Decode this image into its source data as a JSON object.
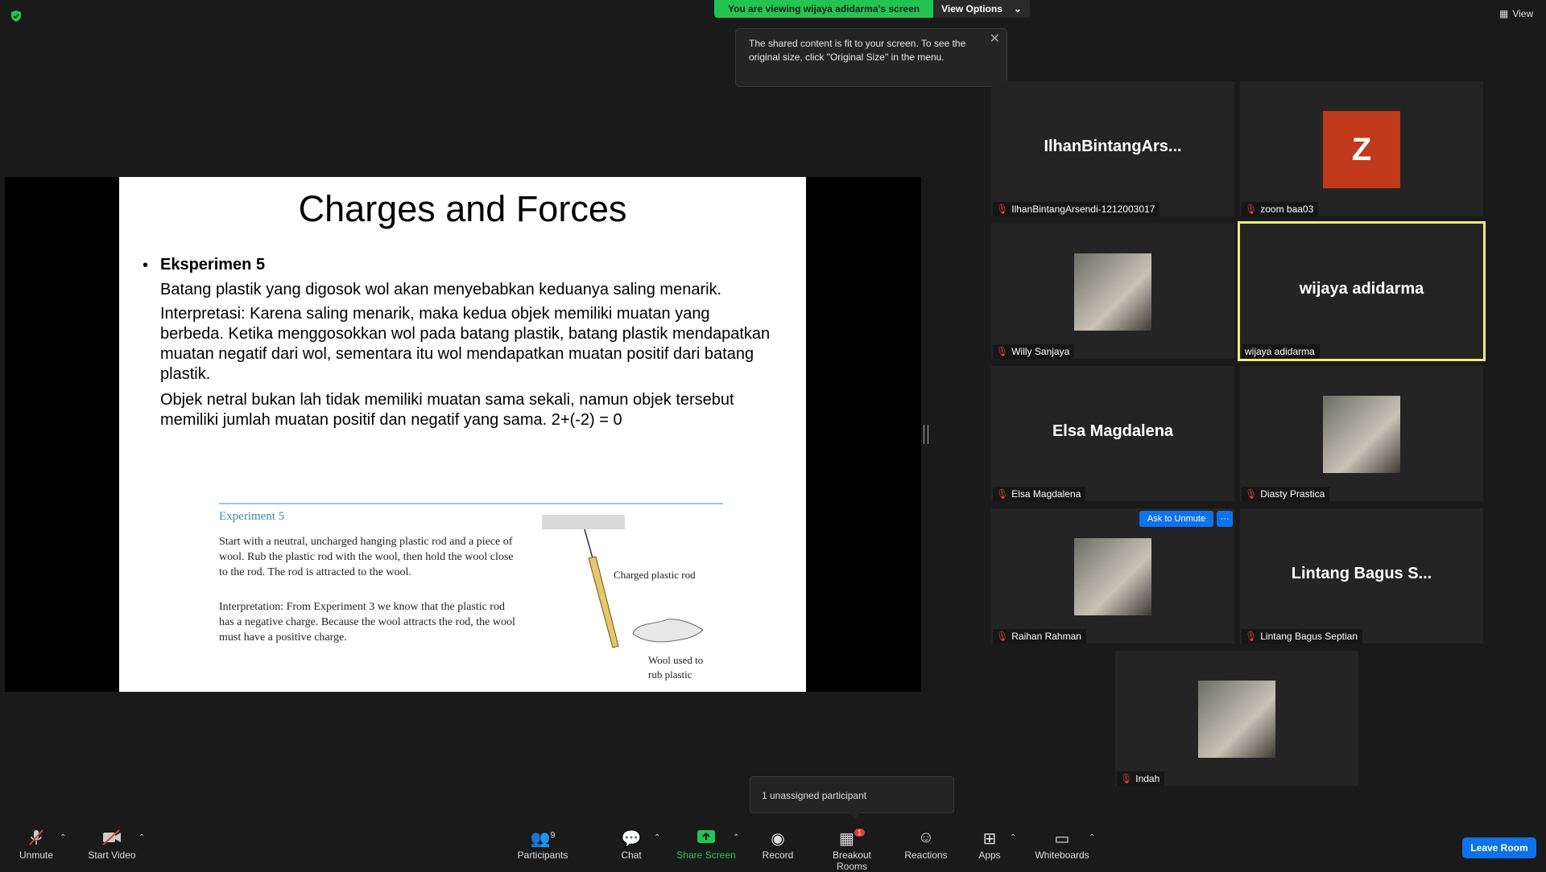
{
  "banner": {
    "viewing": "You are viewing wijaya adidarma's screen",
    "view_options": "View Options"
  },
  "tooltip": {
    "text": "The shared content is fit to your screen. To see the original size, click \"Original Size\" in the menu."
  },
  "view_button": "View",
  "slide": {
    "title": "Charges and Forces",
    "heading": "Eksperimen 5",
    "para1": "Batang plastik yang digosok wol akan menyebabkan keduanya saling menarik.",
    "para2": "Interpretasi: Karena saling menarik, maka kedua objek memiliki muatan yang berbeda. Ketika menggosokkan wol pada batang plastik, batang plastik mendapatkan muatan negatif dari wol, sementara itu wol mendapatkan muatan positif dari batang plastik.",
    "para3": "Objek netral bukan lah tidak memiliki muatan sama sekali, namun objek tersebut memiliki jumlah muatan positif dan negatif yang sama.  2+(-2) = 0",
    "fig_title": "Experiment 5",
    "fig_text1": "Start with a neutral, uncharged hanging plastic rod and a piece of wool. Rub the plastic rod with the wool, then hold the wool close to the rod. The rod is attracted to the wool.",
    "fig_text2": "Interpretation: From Experiment 3 we know that the plastic rod has a negative charge. Because the wool attracts the rod, the wool must have a positive charge.",
    "rod_label": "Charged plastic rod",
    "wool_label1": "Wool used to",
    "wool_label2": "rub plastic"
  },
  "participants": [
    {
      "display": "IlhanBintangArs...",
      "label": "IlhanBintangArsendi-1212003017",
      "type": "name"
    },
    {
      "display": "Z",
      "label": "zoom baa03",
      "type": "letter",
      "color": "#c0391b"
    },
    {
      "display": "",
      "label": "Willy Sanjaya",
      "type": "photo"
    },
    {
      "display": "wijaya adidarma",
      "label": "wijaya adidarma",
      "type": "name",
      "active": true
    },
    {
      "display": "Elsa Magdalena",
      "label": "Elsa Magdalena",
      "type": "name"
    },
    {
      "display": "",
      "label": "Diasty Prastica",
      "type": "photo"
    },
    {
      "display": "",
      "label": "Raihan Rahman",
      "type": "photo"
    },
    {
      "display": "Lintang Bagus S...",
      "label": "Lintang Bagus Septian",
      "type": "name"
    },
    {
      "display": "",
      "label": "Indah",
      "type": "photo"
    }
  ],
  "ask_to_unmute": "Ask to Unmute",
  "more": "···",
  "unassigned": "1 unassigned participant",
  "toolbar": {
    "unmute": "Unmute",
    "start_video": "Start Video",
    "participants": "Participants",
    "participants_count": "9",
    "chat": "Chat",
    "share_screen": "Share Screen",
    "record": "Record",
    "breakout_rooms": "Breakout Rooms",
    "breakout_badge": "1",
    "reactions": "Reactions",
    "apps": "Apps",
    "whiteboards": "Whiteboards",
    "leave": "Leave Room"
  },
  "colors": {
    "accent_green": "#23c552",
    "active_border": "#e5f07a",
    "blue": "#0e72ed",
    "muted_red": "#e03d3d"
  }
}
